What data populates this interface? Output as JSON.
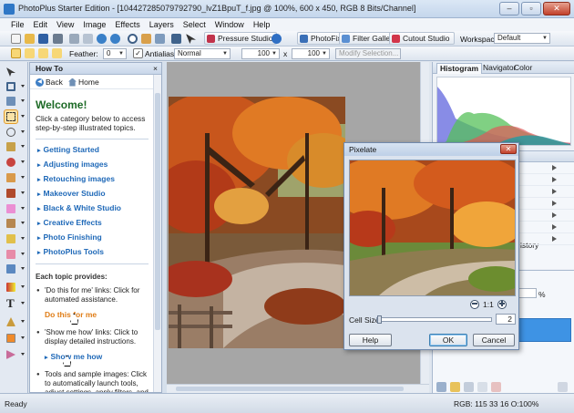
{
  "window": {
    "title": "PhotoPlus Starter Edition - [104427285079792790_lvZ1BpuT_f.jpg @ 100%, 600 x 450, RGB 8 Bits/Channel]"
  },
  "menu": [
    "File",
    "Edit",
    "View",
    "Image",
    "Effects",
    "Layers",
    "Select",
    "Window",
    "Help"
  ],
  "toolbar": {
    "pressure_studio": "Pressure Studio",
    "photofix": "PhotoFix",
    "filter_gallery": "Filter Gallery",
    "cutout_studio": "Cutout Studio",
    "workspace_label": "Workspace",
    "workspace_value": "Default"
  },
  "context_bar": {
    "feather_label": "Feather:",
    "feather_value": "0",
    "antialias_label": "Antialias",
    "blend_mode": "Normal",
    "width_value": "100",
    "times": "x",
    "height_value": "100",
    "modify_selection": "Modify Selection..."
  },
  "howto": {
    "title": "How To",
    "close": "×",
    "back": "Back",
    "home": "Home",
    "welcome": "Welcome!",
    "intro": "Click a category below to access step-by-step illustrated topics.",
    "categories": [
      "Getting Started",
      "Adjusting images",
      "Retouching images",
      "Makeover Studio",
      "Black & White Studio",
      "Creative Effects",
      "Photo Finishing",
      "PhotoPlus Tools"
    ],
    "provides_heading": "Each topic provides:",
    "tip_do_this": "'Do this for me' links: Click for automated assistance.",
    "do_this_link": "Do this for me",
    "tip_show_me": "'Show me how' links: Click to display detailed instructions.",
    "show_me_link": "Show me how",
    "tip_tools": "Tools and sample images: Click to automatically launch tools, adjust settings, apply filters, and so on."
  },
  "right_panel": {
    "tabs": [
      "Histogram",
      "Navigator",
      "Color"
    ],
    "history_tab": "istory",
    "percent_sign": "%"
  },
  "pixelate_dialog": {
    "title": "Pixelate",
    "zoom_level": "1:1",
    "cell_size_label": "Cell Size:",
    "cell_size_value": "2",
    "cell_size_fraction": 0.0,
    "help": "Help",
    "ok": "OK",
    "cancel": "Cancel"
  },
  "status": {
    "left": "Ready",
    "rgb": "RGB: 115 33 16 O:100%"
  },
  "colors": {
    "welcome_green": "#1d6a26",
    "link_blue": "#1f69b8",
    "doit_orange": "#e07d17",
    "layer_selected": "#3e93e4"
  }
}
